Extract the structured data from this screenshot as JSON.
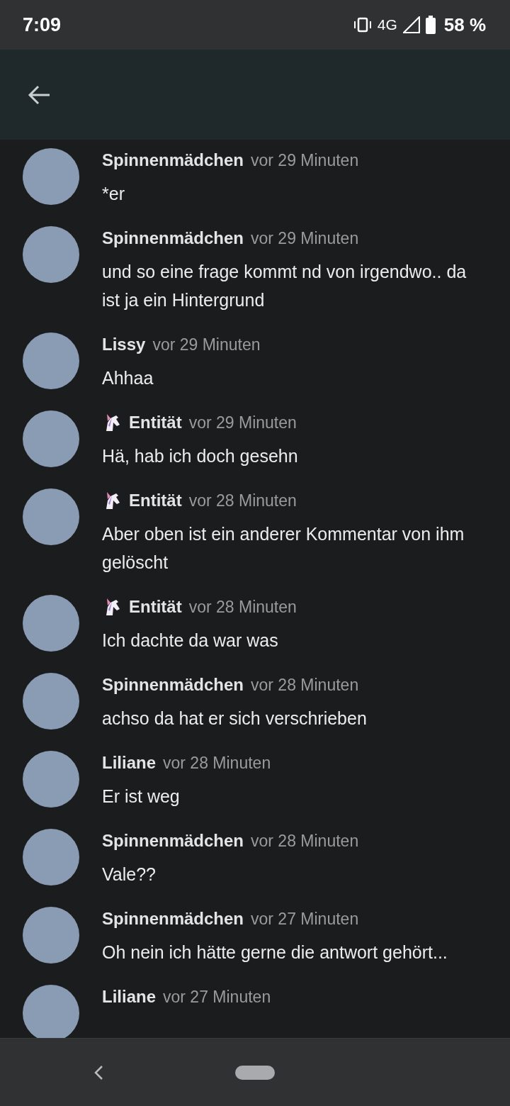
{
  "status_bar": {
    "time": "7:09",
    "network": "4G",
    "battery": "58 %"
  },
  "comments": [
    {
      "author": "Spinnenmädchen",
      "unicorn_badge": false,
      "time": "vor 29 Minuten",
      "text": "*er"
    },
    {
      "author": "Spinnenmädchen",
      "unicorn_badge": false,
      "time": "vor 29 Minuten",
      "text": "und so eine frage kommt nd von irgendwo.. da ist ja ein Hintergrund"
    },
    {
      "author": "Lissy",
      "unicorn_badge": false,
      "time": "vor 29 Minuten",
      "text": "Ahhaa"
    },
    {
      "author": "Entität",
      "unicorn_badge": true,
      "time": "vor 29 Minuten",
      "text": "Hä, hab ich doch gesehn"
    },
    {
      "author": "Entität",
      "unicorn_badge": true,
      "time": "vor 28 Minuten",
      "text": "Aber oben ist ein anderer Kommentar von ihm gelöscht"
    },
    {
      "author": "Entität",
      "unicorn_badge": true,
      "time": "vor 28 Minuten",
      "text": "Ich dachte da war was"
    },
    {
      "author": "Spinnenmädchen",
      "unicorn_badge": false,
      "time": "vor 28 Minuten",
      "text": "achso da hat er sich verschrieben"
    },
    {
      "author": "Liliane",
      "unicorn_badge": false,
      "time": "vor 28 Minuten",
      "text": "Er ist weg"
    },
    {
      "author": "Spinnenmädchen",
      "unicorn_badge": false,
      "time": "vor 28 Minuten",
      "text": "Vale??"
    },
    {
      "author": "Spinnenmädchen",
      "unicorn_badge": false,
      "time": "vor 27 Minuten",
      "text": "Oh nein ich hätte gerne die antwort gehört..."
    },
    {
      "author": "Liliane",
      "unicorn_badge": false,
      "time": "vor 27 Minuten"
    }
  ]
}
